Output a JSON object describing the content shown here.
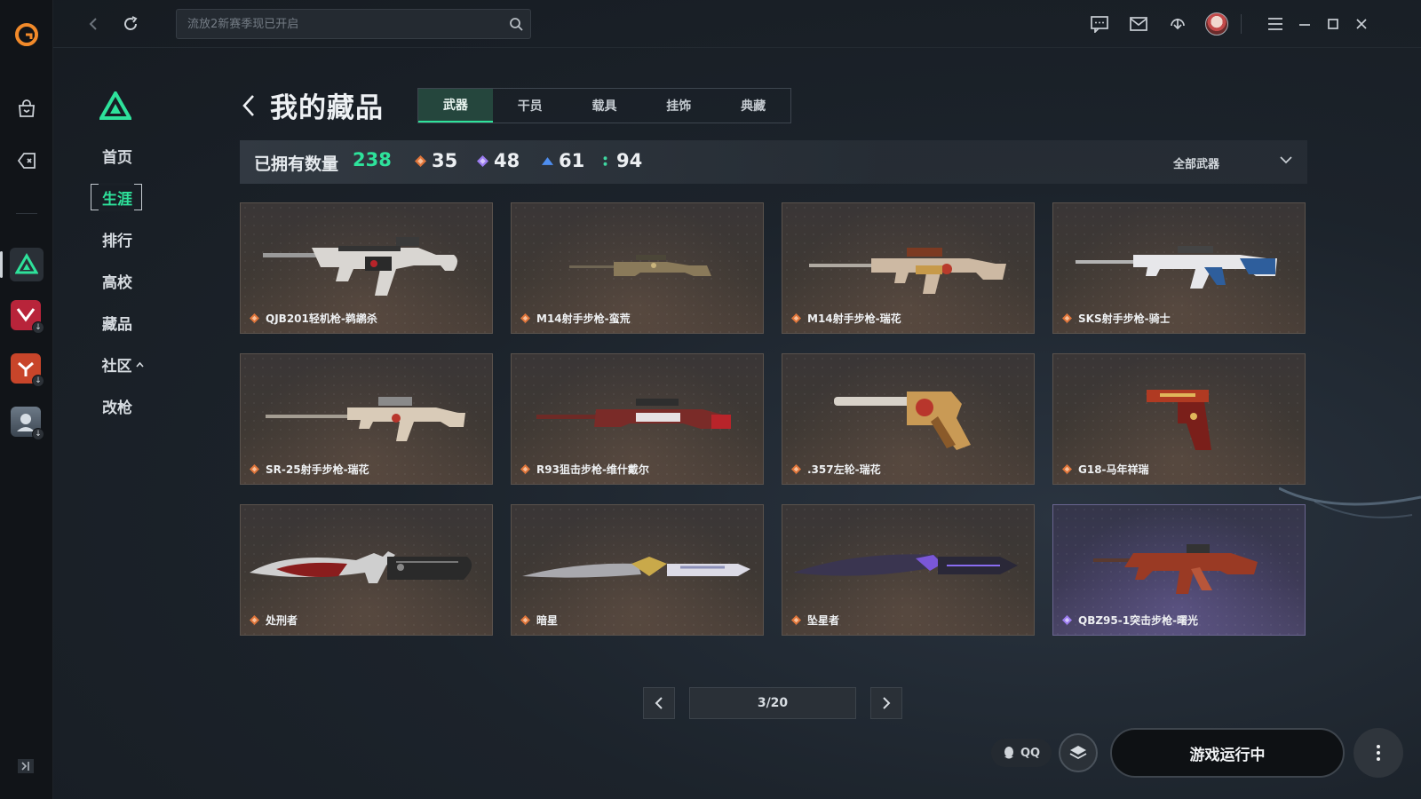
{
  "search": {
    "placeholder": "流放2新赛季现已开启"
  },
  "subnav": {
    "items": [
      {
        "label": "首页"
      },
      {
        "label": "生涯"
      },
      {
        "label": "排行"
      },
      {
        "label": "高校"
      },
      {
        "label": "藏品"
      },
      {
        "label": "社区"
      },
      {
        "label": "改枪"
      }
    ],
    "active_index": 1
  },
  "main": {
    "title": "我的藏品",
    "tabs": [
      {
        "label": "武器"
      },
      {
        "label": "干员"
      },
      {
        "label": "载具"
      },
      {
        "label": "挂饰"
      },
      {
        "label": "典藏"
      }
    ],
    "active_tab": 0
  },
  "stats": {
    "label": "已拥有数量",
    "total": "238",
    "rarities": [
      {
        "value": "35",
        "color": "#e0753a",
        "icon": "diamond-orange-icon"
      },
      {
        "value": "48",
        "color": "#9b7cf0",
        "icon": "diamond-purple-icon"
      },
      {
        "value": "61",
        "color": "#4e8ef0",
        "icon": "diamond-blue-icon"
      },
      {
        "value": "94",
        "color": "#3fd6a0",
        "icon": "diamond-green-icon"
      }
    ],
    "filter_label": "全部武器"
  },
  "items": [
    {
      "name": "QJB201轻机枪-鹈鹕杀",
      "rarity": "orange"
    },
    {
      "name": "M14射手步枪-蛮荒",
      "rarity": "orange"
    },
    {
      "name": "M14射手步枪-瑞花",
      "rarity": "orange"
    },
    {
      "name": "SKS射手步枪-骑士",
      "rarity": "orange"
    },
    {
      "name": "SR-25射手步枪-瑞花",
      "rarity": "orange"
    },
    {
      "name": "R93狙击步枪-维什戴尔",
      "rarity": "orange"
    },
    {
      "name": ".357左轮-瑞花",
      "rarity": "orange"
    },
    {
      "name": "G18-马年祥瑞",
      "rarity": "orange"
    },
    {
      "name": "处刑者",
      "rarity": "orange"
    },
    {
      "name": "暗星",
      "rarity": "orange"
    },
    {
      "name": "坠星者",
      "rarity": "orange"
    },
    {
      "name": "QBZ95-1突击步枪-曙光",
      "rarity": "purple"
    }
  ],
  "pagination": {
    "current": "3/20"
  },
  "footer": {
    "qq_label": "QQ",
    "launch_label": "游戏运行中"
  },
  "colors": {
    "accent": "#2ee29b",
    "orange_rarity": "#e0753a",
    "purple_rarity": "#9b7cf0"
  }
}
